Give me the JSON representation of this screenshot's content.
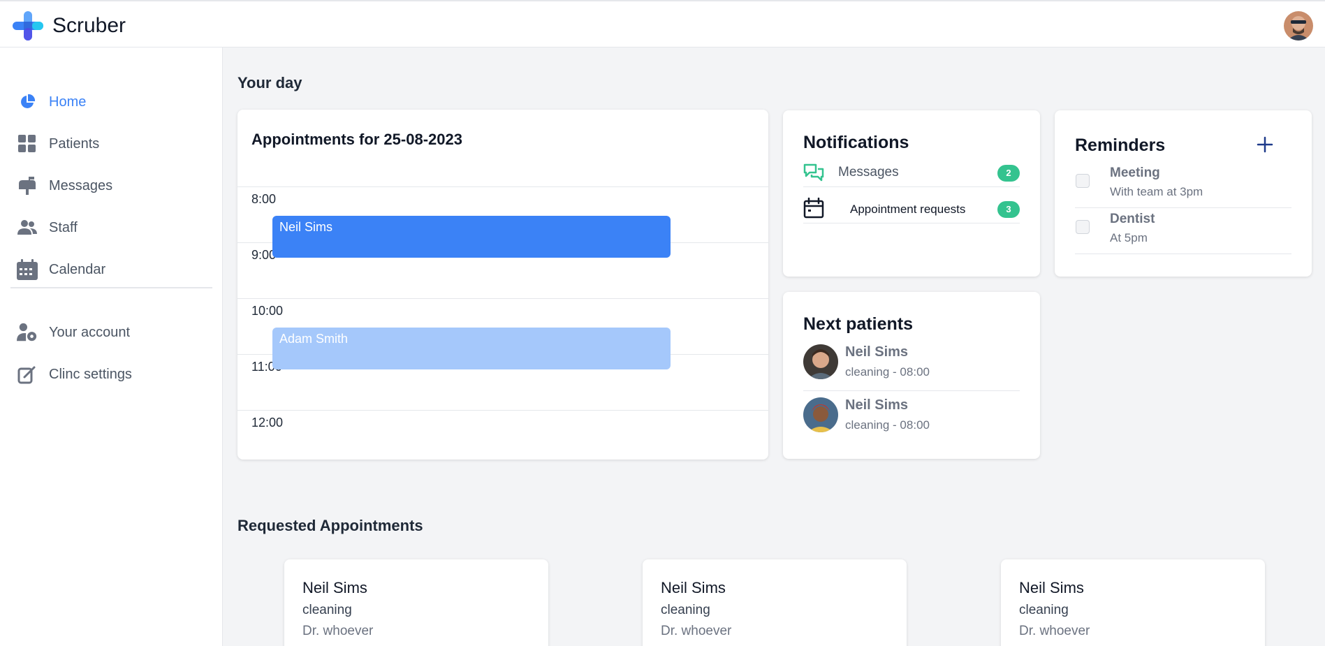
{
  "app": {
    "brand": "Scruber"
  },
  "colors": {
    "accent": "#3b82f6",
    "badge": "#34c38f",
    "event_primary": "#3b82f6",
    "event_secondary": "#a5c8fb"
  },
  "sidebar": {
    "items": [
      {
        "label": "Home",
        "icon": "pie-chart-icon",
        "active": true
      },
      {
        "label": "Patients",
        "icon": "grid-icon"
      },
      {
        "label": "Messages",
        "icon": "mailbox-icon"
      },
      {
        "label": "Staff",
        "icon": "users-icon"
      },
      {
        "label": "Calendar",
        "icon": "calendar-icon"
      }
    ],
    "secondary": [
      {
        "label": "Your account",
        "icon": "user-gear-icon"
      },
      {
        "label": "Clinc settings",
        "icon": "pen-to-square-icon"
      }
    ]
  },
  "main": {
    "section_title": "Your day",
    "appointments": {
      "title": "Appointments for 25-08-2023",
      "hours": [
        "8:00",
        "9:00",
        "10:00",
        "11:00",
        "12:00"
      ],
      "events": [
        {
          "name": "Neil Sims",
          "start": "8:30"
        },
        {
          "name": "Adam Smith",
          "start": "10:30"
        }
      ]
    },
    "notifications": {
      "title": "Notifications",
      "items": [
        {
          "label": "Messages",
          "count": "2",
          "icon": "chat-bubbles-icon"
        },
        {
          "label": "Appointment requests",
          "count": "3",
          "icon": "calendar-icon"
        }
      ]
    },
    "reminders": {
      "title": "Reminders",
      "add_icon": "plus-icon",
      "items": [
        {
          "title": "Meeting",
          "subtitle": "With team at 3pm"
        },
        {
          "title": "Dentist",
          "subtitle": "At 5pm"
        }
      ]
    },
    "next_patients": {
      "title": "Next patients",
      "items": [
        {
          "name": "Neil Sims",
          "detail": "cleaning - 08:00"
        },
        {
          "name": "Neil Sims",
          "detail": "cleaning - 08:00"
        }
      ]
    },
    "requested": {
      "title": "Requested Appointments",
      "items": [
        {
          "name": "Neil Sims",
          "type": "cleaning",
          "doctor": "Dr. whoever"
        },
        {
          "name": "Neil Sims",
          "type": "cleaning",
          "doctor": "Dr. whoever"
        },
        {
          "name": "Neil Sims",
          "type": "cleaning",
          "doctor": "Dr. whoever"
        }
      ]
    }
  }
}
